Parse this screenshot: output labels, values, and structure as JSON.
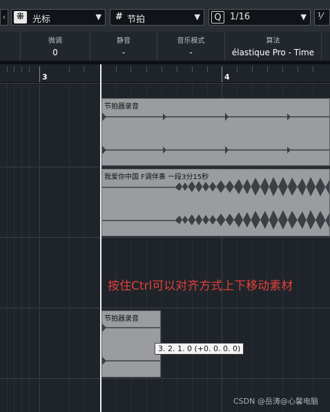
{
  "toolbar": {
    "tool_mode": "光标",
    "snap_mode": "节拍",
    "quantize_icon": "Q",
    "quantize_value": "1/16",
    "extra_icon": "⅟"
  },
  "info_line": {
    "fine_tune_label": "微调",
    "fine_tune_value": "0",
    "mute_label": "静音",
    "mute_value": "-",
    "musical_mode_label": "音乐模式",
    "musical_mode_value": "-",
    "algorithm_label": "算法",
    "algorithm_value": "élastique Pro - Time"
  },
  "ruler": {
    "bar_3": "3",
    "bar_4": "4"
  },
  "tracks": {
    "event_1_title": "节拍器录音",
    "event_2_title": "我爱你中国 F调伴奏 一段3分15秒",
    "event_3_title": "节拍器录音"
  },
  "annotation": "按住Ctrl可以对齐方式上下移动素材",
  "tooltip": "3. 2. 1.  0 (+0. 0. 0.  0)",
  "watermark": "CSDN @岳涛@心馨电脑",
  "colors": {
    "background": "#1f242a",
    "event_fill": "#9a9c9f",
    "waveform": "#3c3f43",
    "annotation": "#e0403a"
  }
}
